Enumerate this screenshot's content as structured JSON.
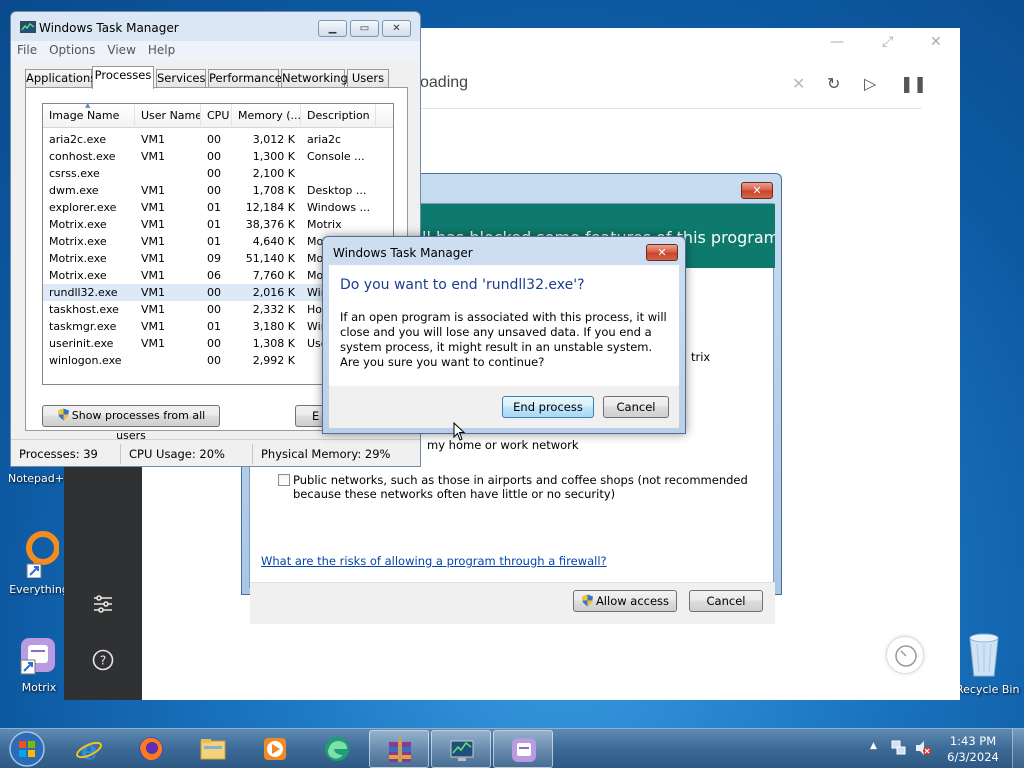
{
  "desktop": {
    "icons": [
      {
        "label": "Notepad++",
        "icon": "notepadpp-icon"
      },
      {
        "label": "Everything",
        "icon": "everything-icon"
      },
      {
        "label": "Motrix",
        "icon": "motrix-icon"
      },
      {
        "label": "Recycle Bin",
        "icon": "recycle-bin-icon"
      }
    ]
  },
  "motrix": {
    "tab_title": "oading"
  },
  "firewall": {
    "banner": "ll has blocked some features of this program",
    "frag_trix": "trix",
    "private_label": "my home or work network",
    "public_label": "Public networks, such as those in airports and coffee shops (not recommended",
    "public_label2": "because these networks often have little or no security)",
    "risk_link": "What are the risks of allowing a program through a firewall?",
    "allow_button": "Allow access",
    "cancel_button": "Cancel"
  },
  "task_manager": {
    "title": "Windows Task Manager",
    "menu": [
      "File",
      "Options",
      "View",
      "Help"
    ],
    "tabs": [
      "Applications",
      "Processes",
      "Services",
      "Performance",
      "Networking",
      "Users"
    ],
    "active_tab": "Processes",
    "columns": [
      "Image Name",
      "User Name",
      "CPU",
      "Memory (...",
      "Description"
    ],
    "rows": [
      {
        "name": "aria2c.exe",
        "user": "VM1",
        "cpu": "00",
        "mem": "3,012 K",
        "desc": "aria2c"
      },
      {
        "name": "conhost.exe",
        "user": "VM1",
        "cpu": "00",
        "mem": "1,300 K",
        "desc": "Console ..."
      },
      {
        "name": "csrss.exe",
        "user": "",
        "cpu": "00",
        "mem": "2,100 K",
        "desc": ""
      },
      {
        "name": "dwm.exe",
        "user": "VM1",
        "cpu": "00",
        "mem": "1,708 K",
        "desc": "Desktop ..."
      },
      {
        "name": "explorer.exe",
        "user": "VM1",
        "cpu": "01",
        "mem": "12,184 K",
        "desc": "Windows ..."
      },
      {
        "name": "Motrix.exe",
        "user": "VM1",
        "cpu": "01",
        "mem": "38,376 K",
        "desc": "Motrix"
      },
      {
        "name": "Motrix.exe",
        "user": "VM1",
        "cpu": "01",
        "mem": "4,640 K",
        "desc": "Mot"
      },
      {
        "name": "Motrix.exe",
        "user": "VM1",
        "cpu": "09",
        "mem": "51,140 K",
        "desc": "Mot"
      },
      {
        "name": "Motrix.exe",
        "user": "VM1",
        "cpu": "06",
        "mem": "7,760 K",
        "desc": "Mot"
      },
      {
        "name": "rundll32.exe",
        "user": "VM1",
        "cpu": "00",
        "mem": "2,016 K",
        "desc": "Win"
      },
      {
        "name": "taskhost.exe",
        "user": "VM1",
        "cpu": "00",
        "mem": "2,332 K",
        "desc": "Hos"
      },
      {
        "name": "taskmgr.exe",
        "user": "VM1",
        "cpu": "01",
        "mem": "3,180 K",
        "desc": "Win"
      },
      {
        "name": "userinit.exe",
        "user": "VM1",
        "cpu": "00",
        "mem": "1,308 K",
        "desc": "Use"
      },
      {
        "name": "winlogon.exe",
        "user": "",
        "cpu": "00",
        "mem": "2,992 K",
        "desc": ""
      }
    ],
    "selected_row": 9,
    "show_all_button": "Show processes from all users",
    "end_button_partial": "E",
    "status": {
      "processes": "Processes: 39",
      "cpu": "CPU Usage: 20%",
      "memory": "Physical Memory: 29%"
    }
  },
  "confirm_dialog": {
    "title": "Windows Task Manager",
    "question": "Do you want to end 'rundll32.exe'?",
    "message": "If an open program is associated with this process, it will close and you will lose any unsaved data. If you end a system process, it might result in an unstable system. Are you sure you want to continue?",
    "end_button": "End process",
    "cancel_button": "Cancel"
  },
  "taskbar": {
    "apps": [
      "internet-explorer-icon",
      "firefox-icon",
      "file-explorer-icon",
      "media-player-icon",
      "edge-icon",
      "winrar-icon",
      "task-manager-icon",
      "motrix-icon"
    ],
    "time": "1:43 PM",
    "date": "6/3/2024"
  },
  "colors": {
    "firewall_banner": "#0e7a6d",
    "dialog_question": "#1a3e8c",
    "selection": "#dde9f7"
  }
}
